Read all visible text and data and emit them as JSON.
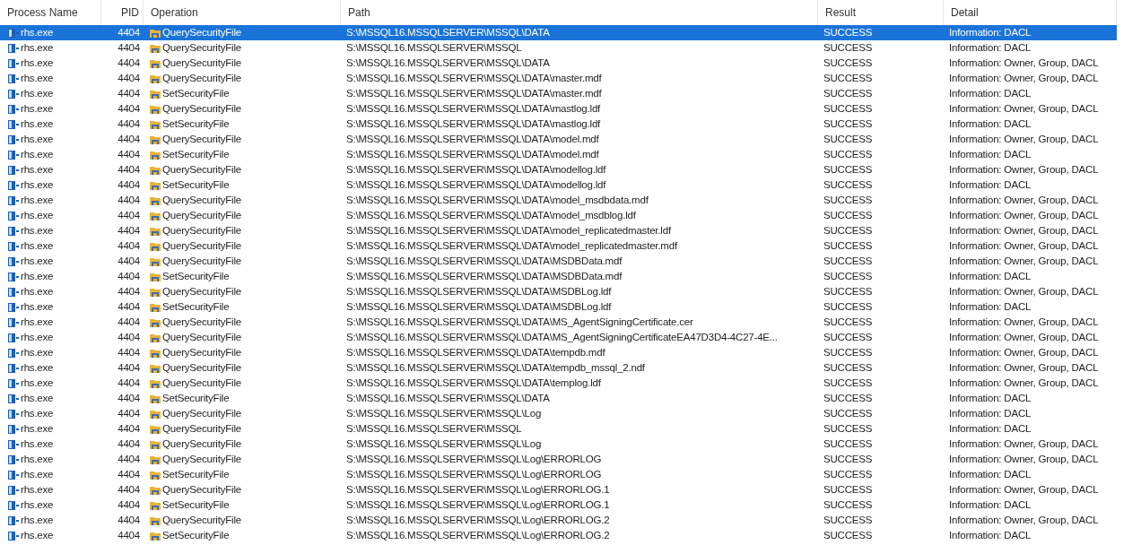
{
  "columns": [
    "Process Name",
    "PID",
    "Operation",
    "Path",
    "Result",
    "Detail"
  ],
  "rows": [
    {
      "process": "rhs.exe",
      "pid": "4404",
      "operation": "QuerySecurityFile",
      "path": "S:\\MSSQL16.MSSQLSERVER\\MSSQL\\DATA",
      "result": "SUCCESS",
      "detail": "Information: DACL",
      "selected": true
    },
    {
      "process": "rhs.exe",
      "pid": "4404",
      "operation": "QuerySecurityFile",
      "path": "S:\\MSSQL16.MSSQLSERVER\\MSSQL",
      "result": "SUCCESS",
      "detail": "Information: DACL",
      "selected": false
    },
    {
      "process": "rhs.exe",
      "pid": "4404",
      "operation": "QuerySecurityFile",
      "path": "S:\\MSSQL16.MSSQLSERVER\\MSSQL\\DATA",
      "result": "SUCCESS",
      "detail": "Information: Owner, Group, DACL",
      "selected": false
    },
    {
      "process": "rhs.exe",
      "pid": "4404",
      "operation": "QuerySecurityFile",
      "path": "S:\\MSSQL16.MSSQLSERVER\\MSSQL\\DATA\\master.mdf",
      "result": "SUCCESS",
      "detail": "Information: Owner, Group, DACL",
      "selected": false
    },
    {
      "process": "rhs.exe",
      "pid": "4404",
      "operation": "SetSecurityFile",
      "path": "S:\\MSSQL16.MSSQLSERVER\\MSSQL\\DATA\\master.mdf",
      "result": "SUCCESS",
      "detail": "Information: DACL",
      "selected": false
    },
    {
      "process": "rhs.exe",
      "pid": "4404",
      "operation": "QuerySecurityFile",
      "path": "S:\\MSSQL16.MSSQLSERVER\\MSSQL\\DATA\\mastlog.ldf",
      "result": "SUCCESS",
      "detail": "Information: Owner, Group, DACL",
      "selected": false
    },
    {
      "process": "rhs.exe",
      "pid": "4404",
      "operation": "SetSecurityFile",
      "path": "S:\\MSSQL16.MSSQLSERVER\\MSSQL\\DATA\\mastlog.ldf",
      "result": "SUCCESS",
      "detail": "Information: DACL",
      "selected": false
    },
    {
      "process": "rhs.exe",
      "pid": "4404",
      "operation": "QuerySecurityFile",
      "path": "S:\\MSSQL16.MSSQLSERVER\\MSSQL\\DATA\\model.mdf",
      "result": "SUCCESS",
      "detail": "Information: Owner, Group, DACL",
      "selected": false
    },
    {
      "process": "rhs.exe",
      "pid": "4404",
      "operation": "SetSecurityFile",
      "path": "S:\\MSSQL16.MSSQLSERVER\\MSSQL\\DATA\\model.mdf",
      "result": "SUCCESS",
      "detail": "Information: DACL",
      "selected": false
    },
    {
      "process": "rhs.exe",
      "pid": "4404",
      "operation": "QuerySecurityFile",
      "path": "S:\\MSSQL16.MSSQLSERVER\\MSSQL\\DATA\\modellog.ldf",
      "result": "SUCCESS",
      "detail": "Information: Owner, Group, DACL",
      "selected": false
    },
    {
      "process": "rhs.exe",
      "pid": "4404",
      "operation": "SetSecurityFile",
      "path": "S:\\MSSQL16.MSSQLSERVER\\MSSQL\\DATA\\modellog.ldf",
      "result": "SUCCESS",
      "detail": "Information: DACL",
      "selected": false
    },
    {
      "process": "rhs.exe",
      "pid": "4404",
      "operation": "QuerySecurityFile",
      "path": "S:\\MSSQL16.MSSQLSERVER\\MSSQL\\DATA\\model_msdbdata.mdf",
      "result": "SUCCESS",
      "detail": "Information: Owner, Group, DACL",
      "selected": false
    },
    {
      "process": "rhs.exe",
      "pid": "4404",
      "operation": "QuerySecurityFile",
      "path": "S:\\MSSQL16.MSSQLSERVER\\MSSQL\\DATA\\model_msdblog.ldf",
      "result": "SUCCESS",
      "detail": "Information: Owner, Group, DACL",
      "selected": false
    },
    {
      "process": "rhs.exe",
      "pid": "4404",
      "operation": "QuerySecurityFile",
      "path": "S:\\MSSQL16.MSSQLSERVER\\MSSQL\\DATA\\model_replicatedmaster.ldf",
      "result": "SUCCESS",
      "detail": "Information: Owner, Group, DACL",
      "selected": false
    },
    {
      "process": "rhs.exe",
      "pid": "4404",
      "operation": "QuerySecurityFile",
      "path": "S:\\MSSQL16.MSSQLSERVER\\MSSQL\\DATA\\model_replicatedmaster.mdf",
      "result": "SUCCESS",
      "detail": "Information: Owner, Group, DACL",
      "selected": false
    },
    {
      "process": "rhs.exe",
      "pid": "4404",
      "operation": "QuerySecurityFile",
      "path": "S:\\MSSQL16.MSSQLSERVER\\MSSQL\\DATA\\MSDBData.mdf",
      "result": "SUCCESS",
      "detail": "Information: Owner, Group, DACL",
      "selected": false
    },
    {
      "process": "rhs.exe",
      "pid": "4404",
      "operation": "SetSecurityFile",
      "path": "S:\\MSSQL16.MSSQLSERVER\\MSSQL\\DATA\\MSDBData.mdf",
      "result": "SUCCESS",
      "detail": "Information: DACL",
      "selected": false
    },
    {
      "process": "rhs.exe",
      "pid": "4404",
      "operation": "QuerySecurityFile",
      "path": "S:\\MSSQL16.MSSQLSERVER\\MSSQL\\DATA\\MSDBLog.ldf",
      "result": "SUCCESS",
      "detail": "Information: Owner, Group, DACL",
      "selected": false
    },
    {
      "process": "rhs.exe",
      "pid": "4404",
      "operation": "SetSecurityFile",
      "path": "S:\\MSSQL16.MSSQLSERVER\\MSSQL\\DATA\\MSDBLog.ldf",
      "result": "SUCCESS",
      "detail": "Information: DACL",
      "selected": false
    },
    {
      "process": "rhs.exe",
      "pid": "4404",
      "operation": "QuerySecurityFile",
      "path": "S:\\MSSQL16.MSSQLSERVER\\MSSQL\\DATA\\MS_AgentSigningCertificate.cer",
      "result": "SUCCESS",
      "detail": "Information: Owner, Group, DACL",
      "selected": false
    },
    {
      "process": "rhs.exe",
      "pid": "4404",
      "operation": "QuerySecurityFile",
      "path": "S:\\MSSQL16.MSSQLSERVER\\MSSQL\\DATA\\MS_AgentSigningCertificateEA47D3D4-4C27-4E...",
      "result": "SUCCESS",
      "detail": "Information: Owner, Group, DACL",
      "selected": false
    },
    {
      "process": "rhs.exe",
      "pid": "4404",
      "operation": "QuerySecurityFile",
      "path": "S:\\MSSQL16.MSSQLSERVER\\MSSQL\\DATA\\tempdb.mdf",
      "result": "SUCCESS",
      "detail": "Information: Owner, Group, DACL",
      "selected": false
    },
    {
      "process": "rhs.exe",
      "pid": "4404",
      "operation": "QuerySecurityFile",
      "path": "S:\\MSSQL16.MSSQLSERVER\\MSSQL\\DATA\\tempdb_mssql_2.ndf",
      "result": "SUCCESS",
      "detail": "Information: Owner, Group, DACL",
      "selected": false
    },
    {
      "process": "rhs.exe",
      "pid": "4404",
      "operation": "QuerySecurityFile",
      "path": "S:\\MSSQL16.MSSQLSERVER\\MSSQL\\DATA\\templog.ldf",
      "result": "SUCCESS",
      "detail": "Information: Owner, Group, DACL",
      "selected": false
    },
    {
      "process": "rhs.exe",
      "pid": "4404",
      "operation": "SetSecurityFile",
      "path": "S:\\MSSQL16.MSSQLSERVER\\MSSQL\\DATA",
      "result": "SUCCESS",
      "detail": "Information: DACL",
      "selected": false
    },
    {
      "process": "rhs.exe",
      "pid": "4404",
      "operation": "QuerySecurityFile",
      "path": "S:\\MSSQL16.MSSQLSERVER\\MSSQL\\Log",
      "result": "SUCCESS",
      "detail": "Information: DACL",
      "selected": false
    },
    {
      "process": "rhs.exe",
      "pid": "4404",
      "operation": "QuerySecurityFile",
      "path": "S:\\MSSQL16.MSSQLSERVER\\MSSQL",
      "result": "SUCCESS",
      "detail": "Information: DACL",
      "selected": false
    },
    {
      "process": "rhs.exe",
      "pid": "4404",
      "operation": "QuerySecurityFile",
      "path": "S:\\MSSQL16.MSSQLSERVER\\MSSQL\\Log",
      "result": "SUCCESS",
      "detail": "Information: Owner, Group, DACL",
      "selected": false
    },
    {
      "process": "rhs.exe",
      "pid": "4404",
      "operation": "QuerySecurityFile",
      "path": "S:\\MSSQL16.MSSQLSERVER\\MSSQL\\Log\\ERRORLOG",
      "result": "SUCCESS",
      "detail": "Information: Owner, Group, DACL",
      "selected": false
    },
    {
      "process": "rhs.exe",
      "pid": "4404",
      "operation": "SetSecurityFile",
      "path": "S:\\MSSQL16.MSSQLSERVER\\MSSQL\\Log\\ERRORLOG",
      "result": "SUCCESS",
      "detail": "Information: DACL",
      "selected": false
    },
    {
      "process": "rhs.exe",
      "pid": "4404",
      "operation": "QuerySecurityFile",
      "path": "S:\\MSSQL16.MSSQLSERVER\\MSSQL\\Log\\ERRORLOG.1",
      "result": "SUCCESS",
      "detail": "Information: Owner, Group, DACL",
      "selected": false
    },
    {
      "process": "rhs.exe",
      "pid": "4404",
      "operation": "SetSecurityFile",
      "path": "S:\\MSSQL16.MSSQLSERVER\\MSSQL\\Log\\ERRORLOG.1",
      "result": "SUCCESS",
      "detail": "Information: DACL",
      "selected": false
    },
    {
      "process": "rhs.exe",
      "pid": "4404",
      "operation": "QuerySecurityFile",
      "path": "S:\\MSSQL16.MSSQLSERVER\\MSSQL\\Log\\ERRORLOG.2",
      "result": "SUCCESS",
      "detail": "Information: Owner, Group, DACL",
      "selected": false
    },
    {
      "process": "rhs.exe",
      "pid": "4404",
      "operation": "SetSecurityFile",
      "path": "S:\\MSSQL16.MSSQLSERVER\\MSSQL\\Log\\ERRORLOG.2",
      "result": "SUCCESS",
      "detail": "Information: DACL",
      "selected": false
    }
  ]
}
